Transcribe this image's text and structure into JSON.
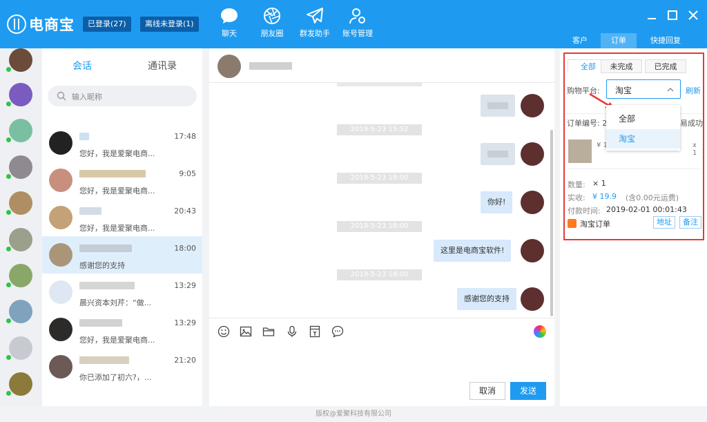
{
  "app": {
    "logo": "电商宝",
    "status_logged_in": "已登录(27)",
    "status_offline": "离线未登录(1)"
  },
  "nav": {
    "chat": "聊天",
    "moments": "朋友圈",
    "broadcast": "群发助手",
    "accounts": "账号管理"
  },
  "right_tabs": [
    "客户",
    "订单",
    "快捷回复"
  ],
  "contacts_panel": {
    "tab_sessions": "会话",
    "tab_contacts": "通讯录",
    "search_placeholder": "输入昵称",
    "conversations": [
      {
        "time": "17:48",
        "message": "您好，我是爱聚电商..."
      },
      {
        "time": "9:05",
        "message": "您好，我是爱聚电商..."
      },
      {
        "time": "20:43",
        "message": "您好，我是爱聚电商..."
      },
      {
        "time": "18:00",
        "message": "感谢您的支持"
      },
      {
        "time": "13:29",
        "message": "晨兴资本刘芹：“做..."
      },
      {
        "time": "13:29",
        "message": "您好，我是爱聚电商..."
      },
      {
        "time": "21:20",
        "message": "你已添加了初六?，..."
      }
    ]
  },
  "chat": {
    "timestamps": [
      "2019-5-23 15:52",
      "2019-5-23 18:00",
      "2019-5-23 18:00",
      "2019-5-23 18:00"
    ],
    "messages": [
      "你好!",
      "这里是电商宝软件!",
      "感谢您的支持"
    ],
    "cancel": "取消",
    "send": "发送"
  },
  "orders": {
    "tab_all": "全部",
    "tab_incomplete": "未完成",
    "tab_completed": "已完成",
    "platform_label": "购物平台:",
    "platform_value": "淘宝",
    "refresh": "刷新",
    "order_no_label": "订单编号: 2",
    "status_text": "易成功",
    "price_prefix": "¥ 1",
    "qty_small": "x 1",
    "qty_label": "数量:",
    "qty_value": "× 1",
    "paid_label": "实收:",
    "paid_value": "¥ 19.9",
    "shipping": "(含0.00元运费)",
    "paytime_label": "付款时间:",
    "paytime_value": "2019-02-01 00:01:43",
    "source": "淘宝订单",
    "address_btn": "地址",
    "note_btn": "备注",
    "dropdown_options": [
      "全部",
      "淘宝"
    ]
  },
  "footer": {
    "copyright": "版权@爱聚科技有限公司"
  }
}
